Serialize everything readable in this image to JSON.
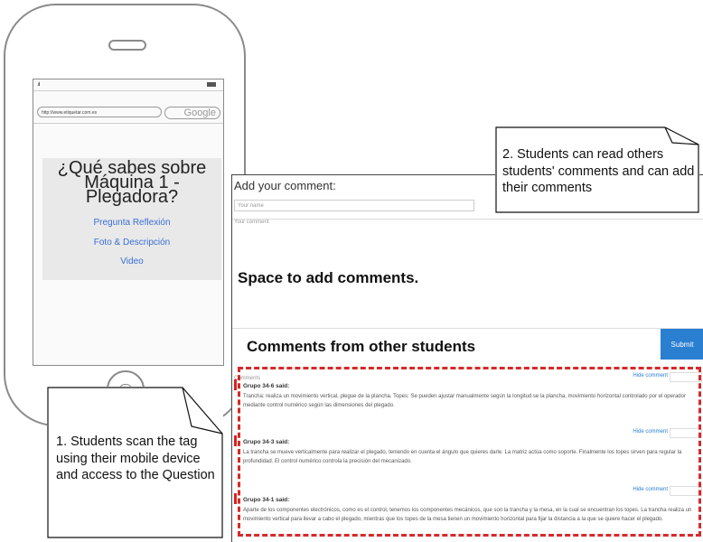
{
  "phone": {
    "url": "http://www.etiquetar.com.es",
    "search_placeholder": "Google",
    "question_title": "¿Qué sabes sobre Máquina 1 - Plegadora?",
    "links": [
      "Pregunta Reflexión",
      "Foto & Descripción",
      "Video"
    ]
  },
  "comments_page": {
    "add_title": "Add your comment:",
    "name_placeholder": "Your name",
    "comment_placeholder": "Your comment",
    "space_label": "Space to add comments.",
    "from_title": "Comments from other students",
    "submit_label": "Submit",
    "comments_label": "Comments",
    "hide_label": "Hide comment",
    "comments": [
      {
        "author": "Grupo 34-6 said:",
        "text": "Trancha: realiza un movimiento vertical, plegue de la plancha. Topes: Se pueden ajustar manualmente según la longitud se la plancha, movimiento horizontal controlado por el operador mediante control numérico según las dimensiones del plegado."
      },
      {
        "author": "Grupo 34-3 said:",
        "text": "La trancha se mueve verticalmente para realizar el plegado, teniendo en cuenta el ángulo que quieres darle. La matriz actúa como soporte. Finalmente los topes sirven para regular la profundidad. El control numérico controla la precisión del mecanizado."
      },
      {
        "author": "Grupo 34-1 said:",
        "text": "Aparte de los componentes electrónicos, como es el control, tenemos los componentes mecánicos, que son la trancha y la mesa, en la cual se encuentran los topes. La trancha realiza un movimiento vertical para llevar a cabo el plegado, mientras que los topes de la mesa tienen un movimiento horizontal para fijar la distancia a la que se quiere hacer el plegado."
      }
    ]
  },
  "notes": {
    "note1": "1. Students scan the tag using their mobile device\nand access to the Question",
    "note2": "2. Students can read others students' comments and can add their comments"
  },
  "colors": {
    "accent_blue": "#2a7fd1",
    "dash_red": "#d42a2a",
    "phone_gray": "#8a8a8a"
  }
}
